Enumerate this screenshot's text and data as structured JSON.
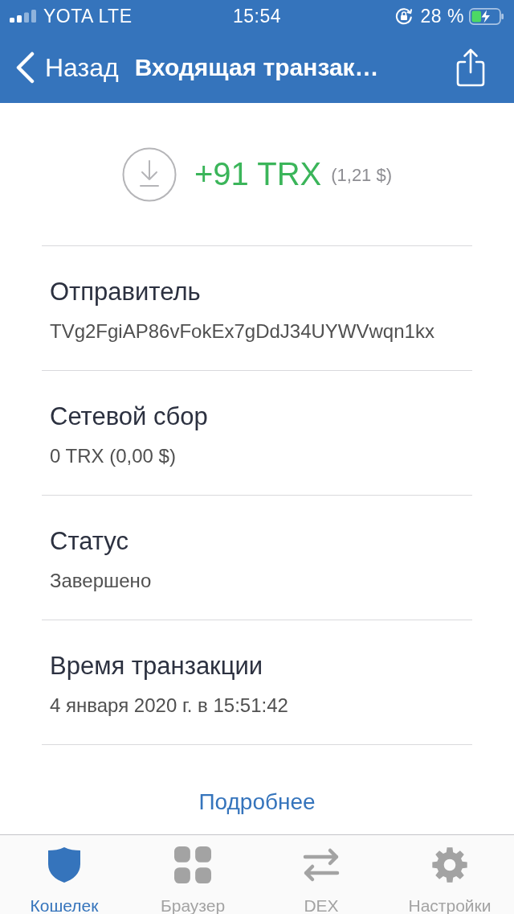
{
  "status_bar": {
    "carrier": "YOTA LTE",
    "time": "15:54",
    "battery_percent": "28 %"
  },
  "nav_bar": {
    "back": "Назад",
    "title": "Входящая транзак…"
  },
  "transaction": {
    "amount": "+91 TRX",
    "fiat_value": "(1,21 $)"
  },
  "details": [
    {
      "label": "Отправитель",
      "value": "TVg2FgiAP86vFokEx7gDdJ34UYWVwqn1kx"
    },
    {
      "label": "Сетевой сбор",
      "value": "0 TRX (0,00 $)"
    },
    {
      "label": "Статус",
      "value": "Завершено"
    },
    {
      "label": "Время транзакции",
      "value": "4 января 2020 г. в 15:51:42"
    }
  ],
  "more_link": "Подробнее",
  "tabs": [
    {
      "label": "Кошелек",
      "selected": true
    },
    {
      "label": "Браузер",
      "selected": false
    },
    {
      "label": "DEX",
      "selected": false
    },
    {
      "label": "Настройки",
      "selected": false
    }
  ]
}
